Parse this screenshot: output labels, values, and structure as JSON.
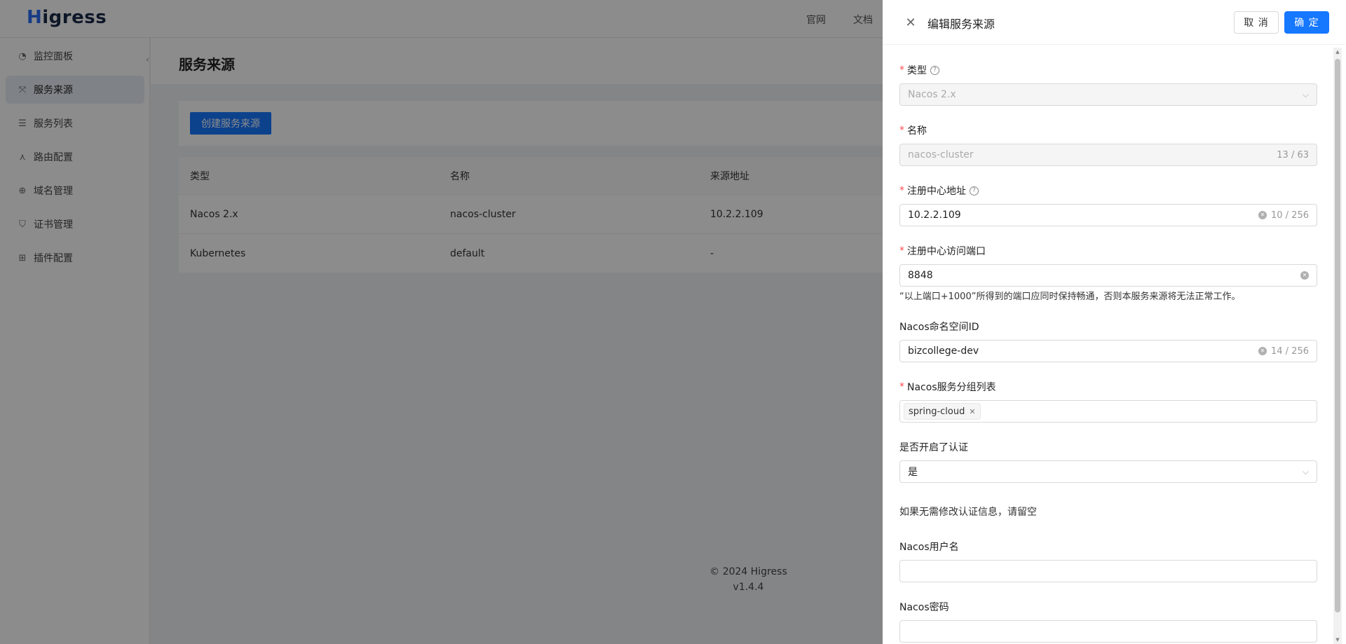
{
  "app": {
    "logo": "Higress",
    "top_nav": [
      "官网",
      "文档"
    ]
  },
  "sidebar": {
    "items": [
      {
        "label": "监控面板",
        "icon": "dashboard-icon"
      },
      {
        "label": "服务来源",
        "icon": "service-source-icon",
        "active": true
      },
      {
        "label": "服务列表",
        "icon": "list-icon"
      },
      {
        "label": "路由配置",
        "icon": "route-icon"
      },
      {
        "label": "域名管理",
        "icon": "globe-icon"
      },
      {
        "label": "证书管理",
        "icon": "shield-icon"
      },
      {
        "label": "插件配置",
        "icon": "plugin-icon"
      }
    ]
  },
  "main": {
    "title": "服务来源",
    "create_button": "创建服务来源",
    "table": {
      "headers": [
        "类型",
        "名称",
        "来源地址"
      ],
      "rows": [
        [
          "Nacos 2.x",
          "nacos-cluster",
          "10.2.2.109"
        ],
        [
          "Kubernetes",
          "default",
          "-"
        ]
      ]
    },
    "footer": {
      "copyright": "© 2024 Higress",
      "version": "v1.4.4"
    }
  },
  "drawer": {
    "title": "编辑服务来源",
    "cancel": "取 消",
    "ok": "确 定",
    "fields": {
      "type": {
        "label": "类型",
        "value": "Nacos 2.x"
      },
      "name": {
        "label": "名称",
        "value": "nacos-cluster",
        "count": "13 / 63"
      },
      "registry": {
        "label": "注册中心地址",
        "value": "10.2.2.109",
        "count": "10 / 256"
      },
      "port": {
        "label": "注册中心访问端口",
        "value": "8848",
        "hint": "“以上端口+1000”所得到的端口应同时保持畅通，否则本服务来源将无法正常工作。"
      },
      "namespace": {
        "label": "Nacos命名空间ID",
        "value": "bizcollege-dev",
        "count": "14 / 256"
      },
      "groups": {
        "label": "Nacos服务分组列表",
        "tags": [
          "spring-cloud"
        ]
      },
      "auth": {
        "label": "是否开启了认证",
        "value": "是"
      },
      "auth_hint": "如果无需修改认证信息，请留空",
      "username": {
        "label": "Nacos用户名",
        "value": ""
      },
      "password": {
        "label": "Nacos密码",
        "value": ""
      }
    }
  }
}
